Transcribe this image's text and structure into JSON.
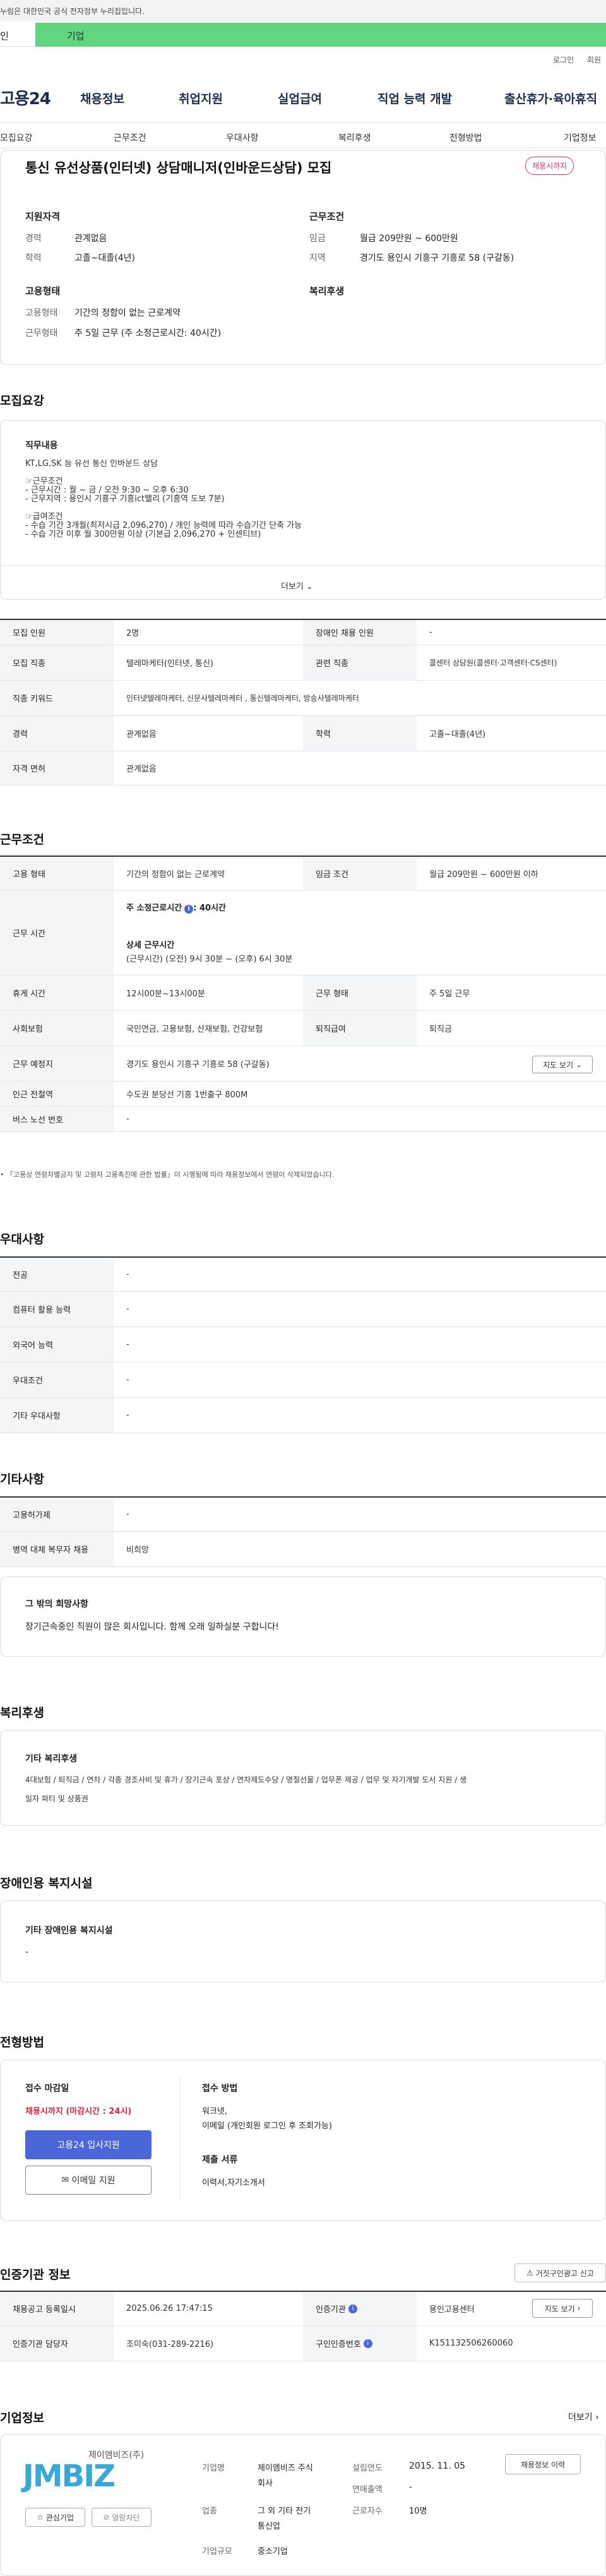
{
  "gov_banner": {
    "text": "누림은 대한민국 공식 전자정부 누리집입니다."
  },
  "segments": {
    "individual": "인",
    "company": "기업"
  },
  "util": {
    "login": "로그인",
    "signup": "회원"
  },
  "logo": {
    "text": "고용24"
  },
  "main_nav": [
    "채용정보",
    "취업지원",
    "실업급여",
    "직업 능력 개발",
    "출산휴가·육아휴직"
  ],
  "tabs": [
    "모집요강",
    "근무조건",
    "우대사항",
    "복리후생",
    "전형방법",
    "기업정보"
  ],
  "job": {
    "title": "통신 유선상품(인터넷) 상담매니저(인바운드상담) 모집",
    "status_pill": "채용시까지",
    "qual_heading": "지원자격",
    "career_label": "경력",
    "career_value": "관계없음",
    "edu_label": "학력",
    "edu_value": "고졸~대졸(4년)",
    "cond_heading": "근무조건",
    "wage_label": "임금",
    "wage_value": "월급 209만원 ~ 600만원",
    "region_label": "지역",
    "region_value": "경기도 용인시 기흥구 기흥로 58 (구갈동)",
    "emp_heading": "고용형태",
    "emp_label": "고용형태",
    "emp_value": "기간의 정함이 없는 근로계약",
    "worktype_label": "근무형태",
    "worktype_value": "주 5일 근무 (주 소정근로시간: 40시간)",
    "welfare_heading": "복리후생"
  },
  "recruit": {
    "heading": "모집요강",
    "box_title": "직무내용",
    "lines": [
      "KT,LG,SK 등 유선 통신 인바운드 상담",
      "",
      "☞근무조건",
      "- 근무시간 : 월 ~ 금 / 오전 9:30 ~ 오후 6:30",
      "- 근무지역 : 용인시 기흥구 기흥ict밸리 (기흥역 도보 7분)",
      "",
      "☞급여조건",
      "- 수습 기간 3개월(최저시급 2,096,270) / 개인 능력에 따라 수습기간 단축 가능",
      "- 수습 기간 이후 월 300만원 이상 (기본급 2,096,270 + 인센티브)"
    ],
    "more": "더보기",
    "table": [
      [
        "모집 인원",
        "2명",
        "장애인 채용 인원",
        "-"
      ],
      [
        "모집 직종",
        "텔레마케터(인터넷, 통신)",
        "관련 직종",
        "콜센터 상담원(콜센터·고객센터·CS센터)"
      ],
      [
        "직종 키워드",
        "인터넷텔레마케터, 신문사텔레마케터 , 통신텔레마케터, 방송사텔레마케터",
        "",
        ""
      ],
      [
        "경력",
        "관계없음",
        "학력",
        "고졸~대졸(4년)"
      ],
      [
        "자격 면허",
        "관계없음",
        "",
        ""
      ]
    ]
  },
  "work": {
    "heading": "근무조건",
    "emp_label": "고용 형태",
    "emp_value": "기간의 정함이 없는 근로계약",
    "wage_label": "임금 조건",
    "wage_value": "월급 209만원 ~ 600만원 이하",
    "time_label": "근무 시간",
    "weekly_label": "주 소정근로시간",
    "weekly_value": ": 40시간",
    "detail_label": "상세 근무시간",
    "detail_value": "(근무시간) (오전) 9시 30분 ~ (오후) 6시 30분",
    "rest_label": "휴게 시간",
    "rest_value": "12시00분~13시00분",
    "form_label": "근무 형태",
    "form_value": "주 5일 근무",
    "ins_label": "사회보험",
    "ins_value": "국민연금, 고용보험, 산재보험, 건강보험",
    "retire_label": "퇴직급여",
    "retire_value": "퇴직금",
    "place_label": "근무 예정지",
    "place_value": "경기도 용인시 기흥구 기흥로 58 (구갈동)",
    "map_btn": "지도 보기",
    "station_label": "인근 전철역",
    "station_value": "수도권 분당선 기흥 1번출구 800M",
    "bus_label": "버스 노선 번호",
    "bus_value": "-",
    "note": "「고용상 연령차별금지 및 고령자 고용촉진에 관한 법률」이 시행됨에 따라 채용정보에서 연령이 삭제되었습니다."
  },
  "prefer": {
    "heading": "우대사항",
    "rows": [
      [
        "전공",
        "-"
      ],
      [
        "컴퓨터 활용 능력",
        "-"
      ],
      [
        "외국어 능력",
        "-"
      ],
      [
        "우대조건",
        "-"
      ],
      [
        "기타 우대사항",
        "-"
      ]
    ]
  },
  "etc": {
    "heading": "기타사항",
    "rows": [
      [
        "고용허가제",
        "-"
      ],
      [
        "병역 대체 복무자 채용",
        "비희망"
      ]
    ],
    "box_title": "그 밖의 희망사항",
    "box_text": "장기근속중인 직원이 많은 회사입니다. 함께 오래 일하실분 구합니다!"
  },
  "welfare": {
    "heading": "복리후생",
    "box_title": "기타 복리후생",
    "line1": "4대보험 / 퇴직금 / 연차 / 각종 경조사비 및 휴가 / 장기근속 포상 / 연차제도수당 / 명절선물 / 업무폰 제공 / 업무 및 자기개발 도서 지원 / 생",
    "line2": "일자 파티 및 상품권"
  },
  "disability": {
    "heading": "장애인용 복지시설",
    "box_title": "기타 장애인용 복지시설",
    "box_value": "-"
  },
  "selection": {
    "heading": "전형방법",
    "deadline_label": "접수 마감일",
    "deadline_value": "채용시까지 (마감시간 : 24시)",
    "apply_btn": "고용24 입사지원",
    "email_btn": "이메일 지원",
    "method_label": "접수 방법",
    "method_line1": "워크넷,",
    "method_line2": "이메일 (개인회원 로그인 후 조회가능)",
    "docs_label": "제출 서류",
    "docs_value": "이력서,자기소개서"
  },
  "cert": {
    "heading": "인증기관 정보",
    "report_btn": "거짓구인광고 신고",
    "rows": [
      [
        "채용공고 등록일시",
        "2025.06.26 17:47:15",
        "인증기관",
        "용인고용센터"
      ],
      [
        "인증기관 담당자",
        "조미숙(031-289-2216)",
        "구인인증번호",
        "K151132506260060"
      ]
    ],
    "map_btn": "지도 보기"
  },
  "company": {
    "heading": "기업정보",
    "more": "더보기",
    "logo_kr": "제이엠비즈(주)",
    "logo_en": "JMBIZ",
    "fav_btn": "관심기업",
    "block_btn": "열람차단",
    "name_label": "기업명",
    "name_value1": "제이엠비즈 주식",
    "name_value2": "회사",
    "year_label": "설립연도",
    "year_value": "2015. 11. 05",
    "biz_label": "업종",
    "biz_value1": "그 외 기타 전기",
    "biz_value2": "통신업",
    "sales_label": "연매출액",
    "sales_value": "-",
    "staff_label": "근로자수",
    "staff_value": "10명",
    "scale_label": "기업규모",
    "scale_value": "중소기업",
    "history_btn": "채용정보 이력"
  },
  "colors": {
    "accent_green": "#63d47f",
    "accent_blue": "#4a66d9",
    "accent_red": "#d9263c",
    "navy": "#1e2d4d"
  }
}
